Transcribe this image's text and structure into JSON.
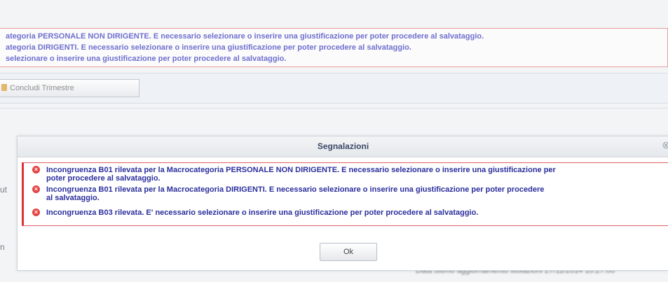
{
  "background": {
    "alerts": [
      "ategoria PERSONALE NON DIRIGENTE. E necessario selezionare o inserire una giustificazione per poter procedere al salvataggio.",
      "ategoria DIRIGENTI. E necessario selezionare o inserire una giustificazione per poter procedere al salvataggio.",
      "selezionare o inserire una giustificazione per poter procedere al salvataggio."
    ],
    "toolbar_button": "Concludi Trimestre",
    "left_fragment_1": "ut",
    "left_fragment_2": "n",
    "bottom_text": "Data ultimo aggiornamento titolazioni 27/11/2014 10:27:00"
  },
  "dialog": {
    "title": "Segnalazioni",
    "close_icon": "close-icon",
    "messages": [
      {
        "line1": "Incongruenza B01 rilevata per la Macrocategoria PERSONALE NON DIRIGENTE. E necessario selezionare o inserire una giustificazione per",
        "line2": "poter procedere al salvataggio."
      },
      {
        "line1": "Incongruenza B01 rilevata per la Macrocategoria DIRIGENTI. E necessario selezionare o inserire una giustificazione per poter procedere",
        "line2": "al salvataggio."
      },
      {
        "line1": "Incongruenza B03 rilevata. E' necessario selezionare o inserire una giustificazione per poter procedere al salvataggio."
      }
    ],
    "ok_label": "Ok"
  },
  "colors": {
    "error": "#e64545",
    "message_text": "#2a2e9c"
  }
}
